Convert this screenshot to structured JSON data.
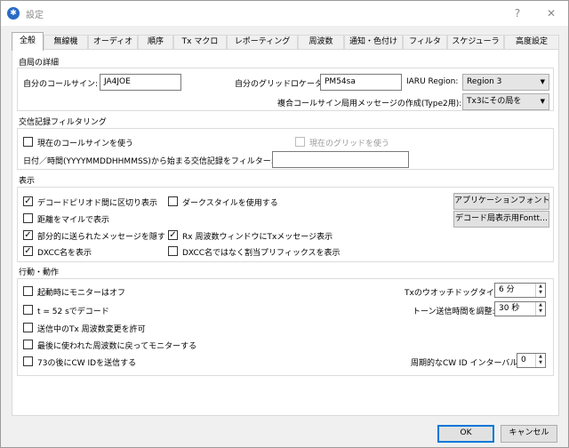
{
  "window": {
    "title": "設定",
    "help": "?",
    "close": "✕"
  },
  "tabs": [
    {
      "label": "全般",
      "active": true
    },
    {
      "label": "無線機"
    },
    {
      "label": "オーディオ"
    },
    {
      "label": "順序"
    },
    {
      "label": "Tx マクロ"
    },
    {
      "label": "レポーティング"
    },
    {
      "label": "周波数"
    },
    {
      "label": "通知・色付け"
    },
    {
      "label": "フィルタ"
    },
    {
      "label": "スケジューラ"
    },
    {
      "label": "高度設定"
    }
  ],
  "station": {
    "heading": "自局の詳細",
    "callsign_label": "自分のコールサイン:",
    "callsign_value": "JA4JOE",
    "grid_label": "自分のグリッドロケータ:",
    "grid_value": "PM54sa",
    "iaru_label": "IARU Region:",
    "iaru_value": "Region 3",
    "type2_label": "複合コールサイン局用メッセージの作成(Type2用):",
    "type2_value": "Tx3にその局を"
  },
  "logfilter": {
    "heading": "交信記録フィルタリング",
    "use_callsign": "現在のコールサインを使う",
    "use_callsign_checked": false,
    "use_grid": "現在のグリッドを使う",
    "use_grid_checked": false,
    "datetime_label": "日付／時間(YYYYMMDDHHMMSS)から始まる交信記録をフィルター:",
    "datetime_value": ""
  },
  "display": {
    "heading": "表示",
    "decode_separator": "デコードピリオド間に区切り表示",
    "decode_separator_checked": true,
    "dark_style": "ダークスタイルを使用する",
    "dark_style_checked": false,
    "distance_miles": "距離をマイルで表示",
    "distance_miles_checked": false,
    "hide_partial": "部分的に送られたメッセージを隠す",
    "hide_partial_checked": true,
    "rx_tx_msg": "Rx 周波数ウィンドウにTxメッセージ表示",
    "rx_tx_msg_checked": true,
    "dxcc_name": "DXCC名を表示",
    "dxcc_name_checked": true,
    "prefix_instead": "DXCC名ではなく割当プリフィックスを表示",
    "prefix_instead_checked": false,
    "app_font_button": "アプリケーションフォント…",
    "decode_font_button": "デコード局表示用Fontt…"
  },
  "behavior": {
    "heading": "行動・動作",
    "monitor_off": "起動時にモニターはオフ",
    "monitor_off_checked": false,
    "t52": "t = 52 sでデコード",
    "t52_checked": false,
    "allow_tx_change": "送信中のTx 周波数変更を許可",
    "allow_tx_change_checked": false,
    "return_last_freq": "最後に使われた周波数に戻ってモニターする",
    "return_last_freq_checked": false,
    "send_cwid": "73の後にCW IDを送信する",
    "send_cwid_checked": false,
    "watchdog_label": "Txのウオッチドッグタイマー:",
    "watchdog_value": "6 分",
    "tune_label": "トーン送信時間を調整:",
    "tune_value": "30 秒",
    "cwid_interval_label": "周期的なCW ID インターバル:",
    "cwid_interval_value": "0"
  },
  "footer": {
    "ok": "OK",
    "cancel": "キャンセル"
  }
}
